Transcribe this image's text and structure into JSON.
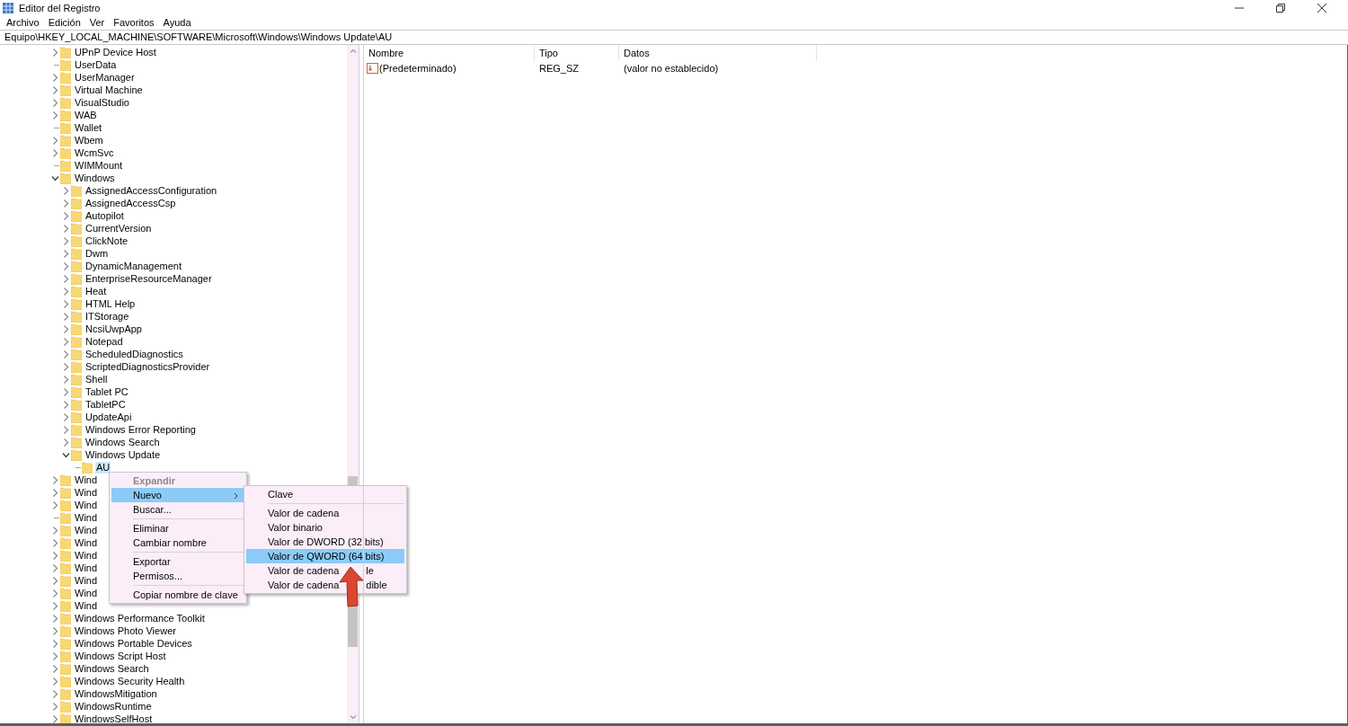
{
  "window": {
    "title": "Editor del Registro"
  },
  "menu_bar": [
    "Archivo",
    "Edición",
    "Ver",
    "Favoritos",
    "Ayuda"
  ],
  "address_bar": {
    "value": "Equipo\\HKEY_LOCAL_MACHINE\\SOFTWARE\\Microsoft\\Windows\\Windows Update\\AU"
  },
  "tree": [
    {
      "label": "UPnP Device Host",
      "expandable": true,
      "expanded": false,
      "selected": false
    },
    {
      "label": "UserData",
      "expandable": false,
      "selected": false
    },
    {
      "label": "UserManager",
      "expandable": true,
      "expanded": false,
      "selected": false
    },
    {
      "label": "Virtual Machine",
      "expandable": true,
      "expanded": false,
      "selected": false
    },
    {
      "label": "VisualStudio",
      "expandable": true,
      "expanded": false,
      "selected": false
    },
    {
      "label": "WAB",
      "expandable": true,
      "expanded": false,
      "selected": false
    },
    {
      "label": "Wallet",
      "expandable": false,
      "selected": false
    },
    {
      "label": "Wbem",
      "expandable": true,
      "expanded": false,
      "selected": false
    },
    {
      "label": "WcmSvc",
      "expandable": true,
      "expanded": false,
      "selected": false
    },
    {
      "label": "WIMMount",
      "expandable": false,
      "selected": false
    },
    {
      "label": "Windows",
      "expandable": true,
      "expanded": true,
      "selected": false,
      "children": [
        {
          "label": "AssignedAccessConfiguration",
          "expandable": true,
          "expanded": false,
          "selected": false
        },
        {
          "label": "AssignedAccessCsp",
          "expandable": true,
          "expanded": false,
          "selected": false
        },
        {
          "label": "Autopilot",
          "expandable": true,
          "expanded": false,
          "selected": false
        },
        {
          "label": "CurrentVersion",
          "expandable": true,
          "expanded": false,
          "selected": false
        },
        {
          "label": "ClickNote",
          "expandable": true,
          "expanded": false,
          "selected": false
        },
        {
          "label": "Dwm",
          "expandable": true,
          "expanded": false,
          "selected": false
        },
        {
          "label": "DynamicManagement",
          "expandable": true,
          "expanded": false,
          "selected": false
        },
        {
          "label": "EnterpriseResourceManager",
          "expandable": true,
          "expanded": false,
          "selected": false
        },
        {
          "label": "Heat",
          "expandable": true,
          "expanded": false,
          "selected": false
        },
        {
          "label": "HTML Help",
          "expandable": true,
          "expanded": false,
          "selected": false
        },
        {
          "label": "ITStorage",
          "expandable": true,
          "expanded": false,
          "selected": false
        },
        {
          "label": "NcsiUwpApp",
          "expandable": true,
          "expanded": false,
          "selected": false
        },
        {
          "label": "Notepad",
          "expandable": true,
          "expanded": false,
          "selected": false
        },
        {
          "label": "ScheduledDiagnostics",
          "expandable": true,
          "expanded": false,
          "selected": false
        },
        {
          "label": "ScriptedDiagnosticsProvider",
          "expandable": true,
          "expanded": false,
          "selected": false
        },
        {
          "label": "Shell",
          "expandable": true,
          "expanded": false,
          "selected": false
        },
        {
          "label": "Tablet PC",
          "expandable": true,
          "expanded": false,
          "selected": false
        },
        {
          "label": "TabletPC",
          "expandable": true,
          "expanded": false,
          "selected": false
        },
        {
          "label": "UpdateApi",
          "expandable": true,
          "expanded": false,
          "selected": false
        },
        {
          "label": "Windows Error Reporting",
          "expandable": true,
          "expanded": false,
          "selected": false
        },
        {
          "label": "Windows Search",
          "expandable": true,
          "expanded": false,
          "selected": false
        },
        {
          "label": "Windows Update",
          "expandable": true,
          "expanded": true,
          "selected": false,
          "children": [
            {
              "label": "AU",
              "expandable": false,
              "selected": true
            }
          ]
        }
      ]
    },
    {
      "label": "Wind",
      "expandable": true,
      "expanded": false,
      "selected": false
    },
    {
      "label": "Wind",
      "expandable": true,
      "expanded": false,
      "selected": false
    },
    {
      "label": "Wind",
      "expandable": true,
      "expanded": false,
      "selected": false
    },
    {
      "label": "Wind",
      "expandable": false,
      "selected": false
    },
    {
      "label": "Wind",
      "expandable": true,
      "expanded": false,
      "selected": false
    },
    {
      "label": "Wind",
      "expandable": true,
      "expanded": false,
      "selected": false
    },
    {
      "label": "Wind",
      "expandable": true,
      "expanded": false,
      "selected": false
    },
    {
      "label": "Wind",
      "expandable": true,
      "expanded": false,
      "selected": false
    },
    {
      "label": "Wind",
      "expandable": true,
      "expanded": false,
      "selected": false
    },
    {
      "label": "Wind",
      "expandable": true,
      "expanded": false,
      "selected": false
    },
    {
      "label": "Wind",
      "expandable": true,
      "expanded": false,
      "selected": false
    },
    {
      "label": "Windows Performance Toolkit",
      "expandable": true,
      "expanded": false,
      "selected": false
    },
    {
      "label": "Windows Photo Viewer",
      "expandable": true,
      "expanded": false,
      "selected": false
    },
    {
      "label": "Windows Portable Devices",
      "expandable": true,
      "expanded": false,
      "selected": false
    },
    {
      "label": "Windows Script Host",
      "expandable": true,
      "expanded": false,
      "selected": false
    },
    {
      "label": "Windows Search",
      "expandable": true,
      "expanded": false,
      "selected": false
    },
    {
      "label": "Windows Security Health",
      "expandable": true,
      "expanded": false,
      "selected": false
    },
    {
      "label": "WindowsMitigation",
      "expandable": true,
      "expanded": false,
      "selected": false
    },
    {
      "label": "WindowsRuntime",
      "expandable": true,
      "expanded": false,
      "selected": false
    },
    {
      "label": "WindowsSelfHost",
      "expandable": true,
      "expanded": false,
      "selected": false
    }
  ],
  "values_list": {
    "columns": [
      "Nombre",
      "Tipo",
      "Datos"
    ],
    "rows": [
      {
        "name": "(Predeterminado)",
        "type": "REG_SZ",
        "data": "(valor no establecido)"
      }
    ]
  },
  "context_menu": [
    {
      "kind": "item",
      "label": "Expandir",
      "disabled": true,
      "selected": false,
      "submenu": false
    },
    {
      "kind": "item",
      "label": "Nuevo",
      "disabled": false,
      "selected": true,
      "submenu": true
    },
    {
      "kind": "item",
      "label": "Buscar...",
      "disabled": false,
      "selected": false,
      "submenu": false
    },
    {
      "kind": "separator"
    },
    {
      "kind": "item",
      "label": "Eliminar",
      "disabled": false,
      "selected": false,
      "submenu": false
    },
    {
      "kind": "item",
      "label": "Cambiar nombre",
      "disabled": false,
      "selected": false,
      "submenu": false
    },
    {
      "kind": "separator"
    },
    {
      "kind": "item",
      "label": "Exportar",
      "disabled": false,
      "selected": false,
      "submenu": false
    },
    {
      "kind": "item",
      "label": "Permisos...",
      "disabled": false,
      "selected": false,
      "submenu": false
    },
    {
      "kind": "separator"
    },
    {
      "kind": "item",
      "label": "Copiar nombre de clave",
      "disabled": false,
      "selected": false,
      "submenu": false
    }
  ],
  "submenu": [
    {
      "kind": "item",
      "label": "Clave",
      "disabled": false,
      "selected": false,
      "submenu": false
    },
    {
      "kind": "separator"
    },
    {
      "kind": "item",
      "label": "Valor de cadena",
      "disabled": false,
      "selected": false,
      "submenu": false
    },
    {
      "kind": "item",
      "label": "Valor binario",
      "disabled": false,
      "selected": false,
      "submenu": false
    },
    {
      "kind": "item",
      "label": "Valor de DWORD (32 bits)",
      "disabled": false,
      "selected": false,
      "submenu": false
    },
    {
      "kind": "item",
      "label": "Valor de QWORD (64 bits)",
      "disabled": false,
      "selected": true,
      "submenu": false
    },
    {
      "kind": "item",
      "label": "Valor de cadena",
      "tail": "le",
      "disabled": false,
      "selected": false,
      "submenu": false
    },
    {
      "kind": "item",
      "label": "Valor de cadena",
      "tail": "dible",
      "disabled": false,
      "selected": false,
      "submenu": false
    }
  ]
}
